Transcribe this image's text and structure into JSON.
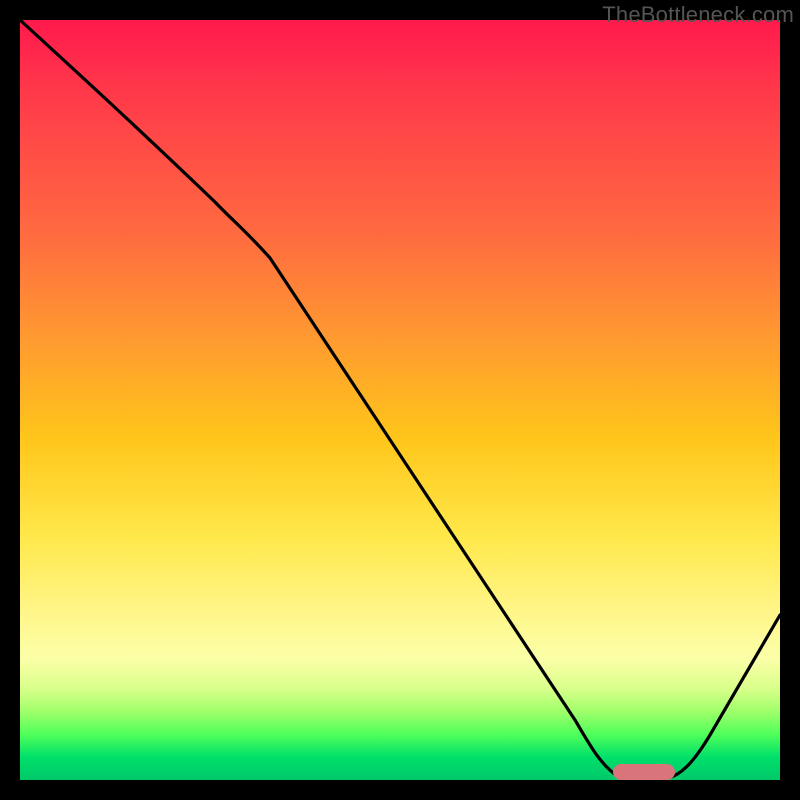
{
  "watermark": "TheBottleneck.com",
  "colors": {
    "curve_stroke": "#000000",
    "marker_fill": "#d9757a",
    "frame_bg": "#000000"
  },
  "chart_data": {
    "type": "line",
    "title": "",
    "xlabel": "",
    "ylabel": "",
    "xlim": [
      0,
      100
    ],
    "ylim": [
      0,
      100
    ],
    "grid": false,
    "legend": false,
    "note": "Values estimated from pixel positions; y=100 at top, y=0 at bottom.",
    "series": [
      {
        "name": "bottleneck-curve",
        "x": [
          0,
          10,
          20,
          28,
          36,
          44,
          52,
          60,
          68,
          74,
          78,
          82,
          86,
          90,
          94,
          100
        ],
        "y": [
          100,
          90,
          80,
          73,
          62,
          52,
          41,
          31,
          20,
          10,
          3,
          0,
          0,
          4,
          10,
          22
        ]
      }
    ],
    "optimal_marker": {
      "x_range": [
        78,
        86
      ],
      "y": 0
    },
    "gradient_stops": [
      {
        "pos": 0.0,
        "color": "#ff1a4d"
      },
      {
        "pos": 0.28,
        "color": "#ff6a40"
      },
      {
        "pos": 0.55,
        "color": "#ffc61a"
      },
      {
        "pos": 0.78,
        "color": "#fff68a"
      },
      {
        "pos": 0.94,
        "color": "#4fff5a"
      },
      {
        "pos": 1.0,
        "color": "#00c86a"
      }
    ]
  }
}
